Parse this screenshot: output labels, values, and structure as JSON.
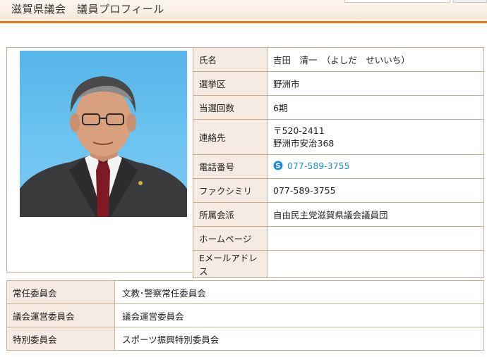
{
  "header": {
    "title": "滋賀県議会　議員プロフィール"
  },
  "profile": {
    "rows": [
      {
        "label": "氏名",
        "value": "吉田　清一　（よしだ　せいいち）"
      },
      {
        "label": "選挙区",
        "value": "野洲市"
      },
      {
        "label": "当選回数",
        "value": "6期"
      },
      {
        "label": "連絡先",
        "lines": [
          "〒520-2411",
          "野洲市安治368"
        ]
      },
      {
        "label": "電話番号",
        "value": "077-589-3755"
      },
      {
        "label": "ファクシミリ",
        "value": "077-589-3755"
      },
      {
        "label": "所属会派",
        "value": "自由民主党滋賀県議会議員団"
      },
      {
        "label": "ホームページ",
        "value": ""
      },
      {
        "label": "Eメールアドレス",
        "value": ""
      }
    ]
  },
  "committees": [
    {
      "label": "常任委員会",
      "value": "文教･警察常任委員会"
    },
    {
      "label": "議会運営委員会",
      "value": "議会運営委員会"
    },
    {
      "label": "特別委員会",
      "value": "スポーツ振興特別委員会"
    }
  ],
  "colors": {
    "accent": "#e07a1f",
    "label_bg": "#f5ebe2",
    "border": "#c9ad93",
    "link": "#1a8fd8"
  },
  "icons": {
    "phone": "skype-icon"
  }
}
